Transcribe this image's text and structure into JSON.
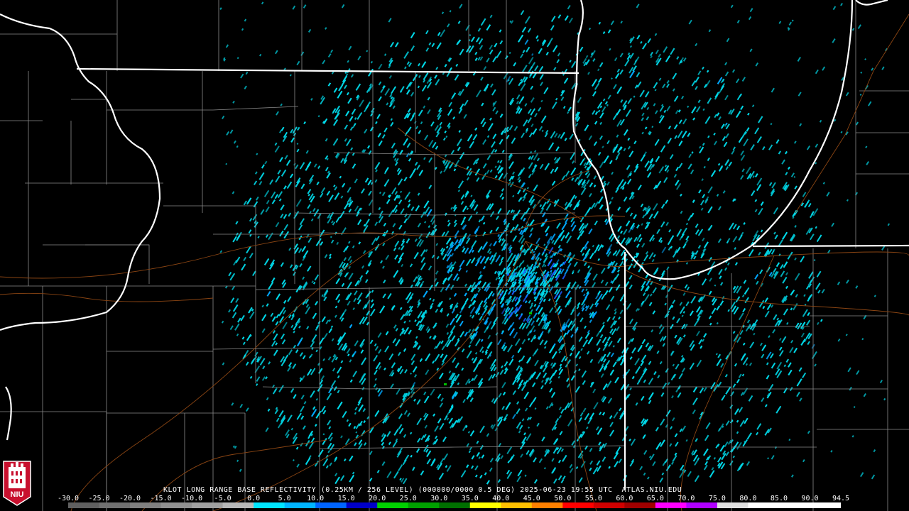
{
  "product_caption": "KLOT LONG RANGE BASE REFLECTIVITY (0.25KM / 256 LEVEL) (000000/0000 0.5 DEG) 2025-06-23 19:55 UTC  ATLAS.NIU.EDU",
  "scale": {
    "labels": [
      "-30.0",
      "-25.0",
      "-20.0",
      "-15.0",
      "-10.0",
      "-5.0",
      "0.0",
      "5.0",
      "10.0",
      "15.0",
      "20.0",
      "25.0",
      "30.0",
      "35.0",
      "40.0",
      "45.0",
      "50.0",
      "55.0",
      "60.0",
      "65.0",
      "70.0",
      "75.0",
      "80.0",
      "85.0",
      "90.0",
      "94.5"
    ],
    "colors": [
      "#606060",
      "#707070",
      "#808080",
      "#909090",
      "#a0a0a0",
      "#b8b8b8",
      "#00e5ff",
      "#00b4ff",
      "#0064ff",
      "#0000c8",
      "#00d000",
      "#00a000",
      "#007000",
      "#ffff00",
      "#ffc000",
      "#ff8000",
      "#ff0000",
      "#d00000",
      "#a00000",
      "#ff00ff",
      "#b000ff",
      "#e0e0e0",
      "#ffffff",
      "#ffffff",
      "#ffffff"
    ]
  },
  "echo_colors": {
    "light": "#00d8e8",
    "medium": "#00a8ff",
    "heavy": "#1e5cff",
    "trace_green": "#00c000"
  },
  "map_colors": {
    "state_border": "#ffffff",
    "county_line": "#8a8a8a",
    "road": "#8b4513"
  },
  "logo": {
    "text": "NIU",
    "color": "#c8102e"
  }
}
